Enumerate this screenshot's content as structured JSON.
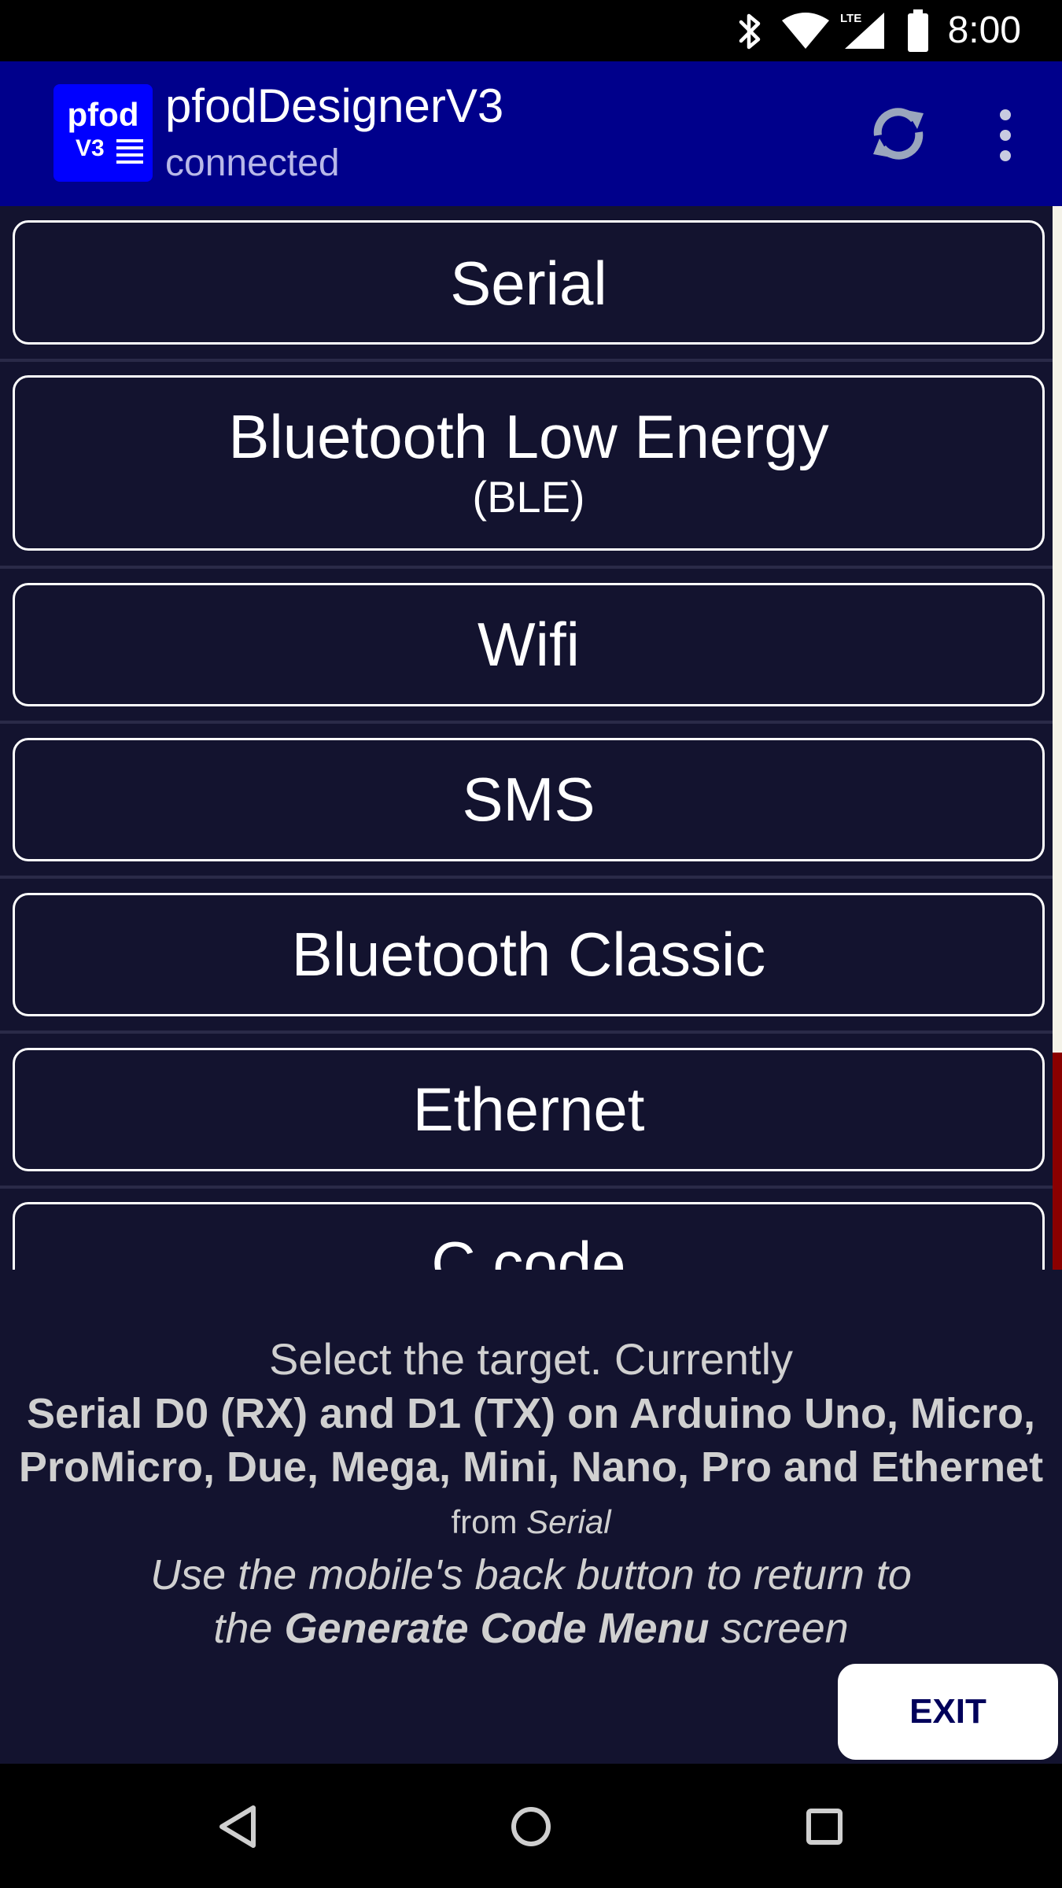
{
  "status_bar": {
    "time": "8:00",
    "network_label": "LTE",
    "icons": [
      "bluetooth-icon",
      "wifi-icon",
      "lte-signal-icon",
      "battery-icon"
    ]
  },
  "app_bar": {
    "logo_text_top": "pfod",
    "logo_text_bottom": "V3",
    "title": "pfodDesignerV3",
    "subtitle": "connected",
    "colors": {
      "bar": "#00008b",
      "logo": "#0000ff",
      "subtitle": "#b8b8e8"
    }
  },
  "list": {
    "items": [
      {
        "label": "Serial",
        "sub": ""
      },
      {
        "label": "Bluetooth Low Energy",
        "sub": "(BLE)"
      },
      {
        "label": "Wifi",
        "sub": ""
      },
      {
        "label": "SMS",
        "sub": ""
      },
      {
        "label": "Bluetooth Classic",
        "sub": ""
      },
      {
        "label": "Ethernet",
        "sub": ""
      },
      {
        "label": "C code",
        "sub": ""
      }
    ],
    "colors": {
      "background": "#13132f",
      "border": "#ffffff",
      "scroll_thumb": "#8a0000"
    }
  },
  "info": {
    "line1": "Select the target. Currently",
    "line2": "Serial D0 (RX) and D1 (TX) on Arduino Uno, Micro,",
    "line3": "ProMicro, Due, Mega, Mini, Nano, Pro and Ethernet",
    "line4_prefix": "from ",
    "line4_italic": "Serial",
    "line5": "Use the mobile's back button to return to",
    "line6_prefix": "the ",
    "line6_bold": "Generate Code Menu",
    "line6_suffix": " screen"
  },
  "exit_button": {
    "label": "EXIT"
  },
  "nav_bar": {
    "icons": [
      "back-icon",
      "home-icon",
      "recents-icon"
    ]
  }
}
